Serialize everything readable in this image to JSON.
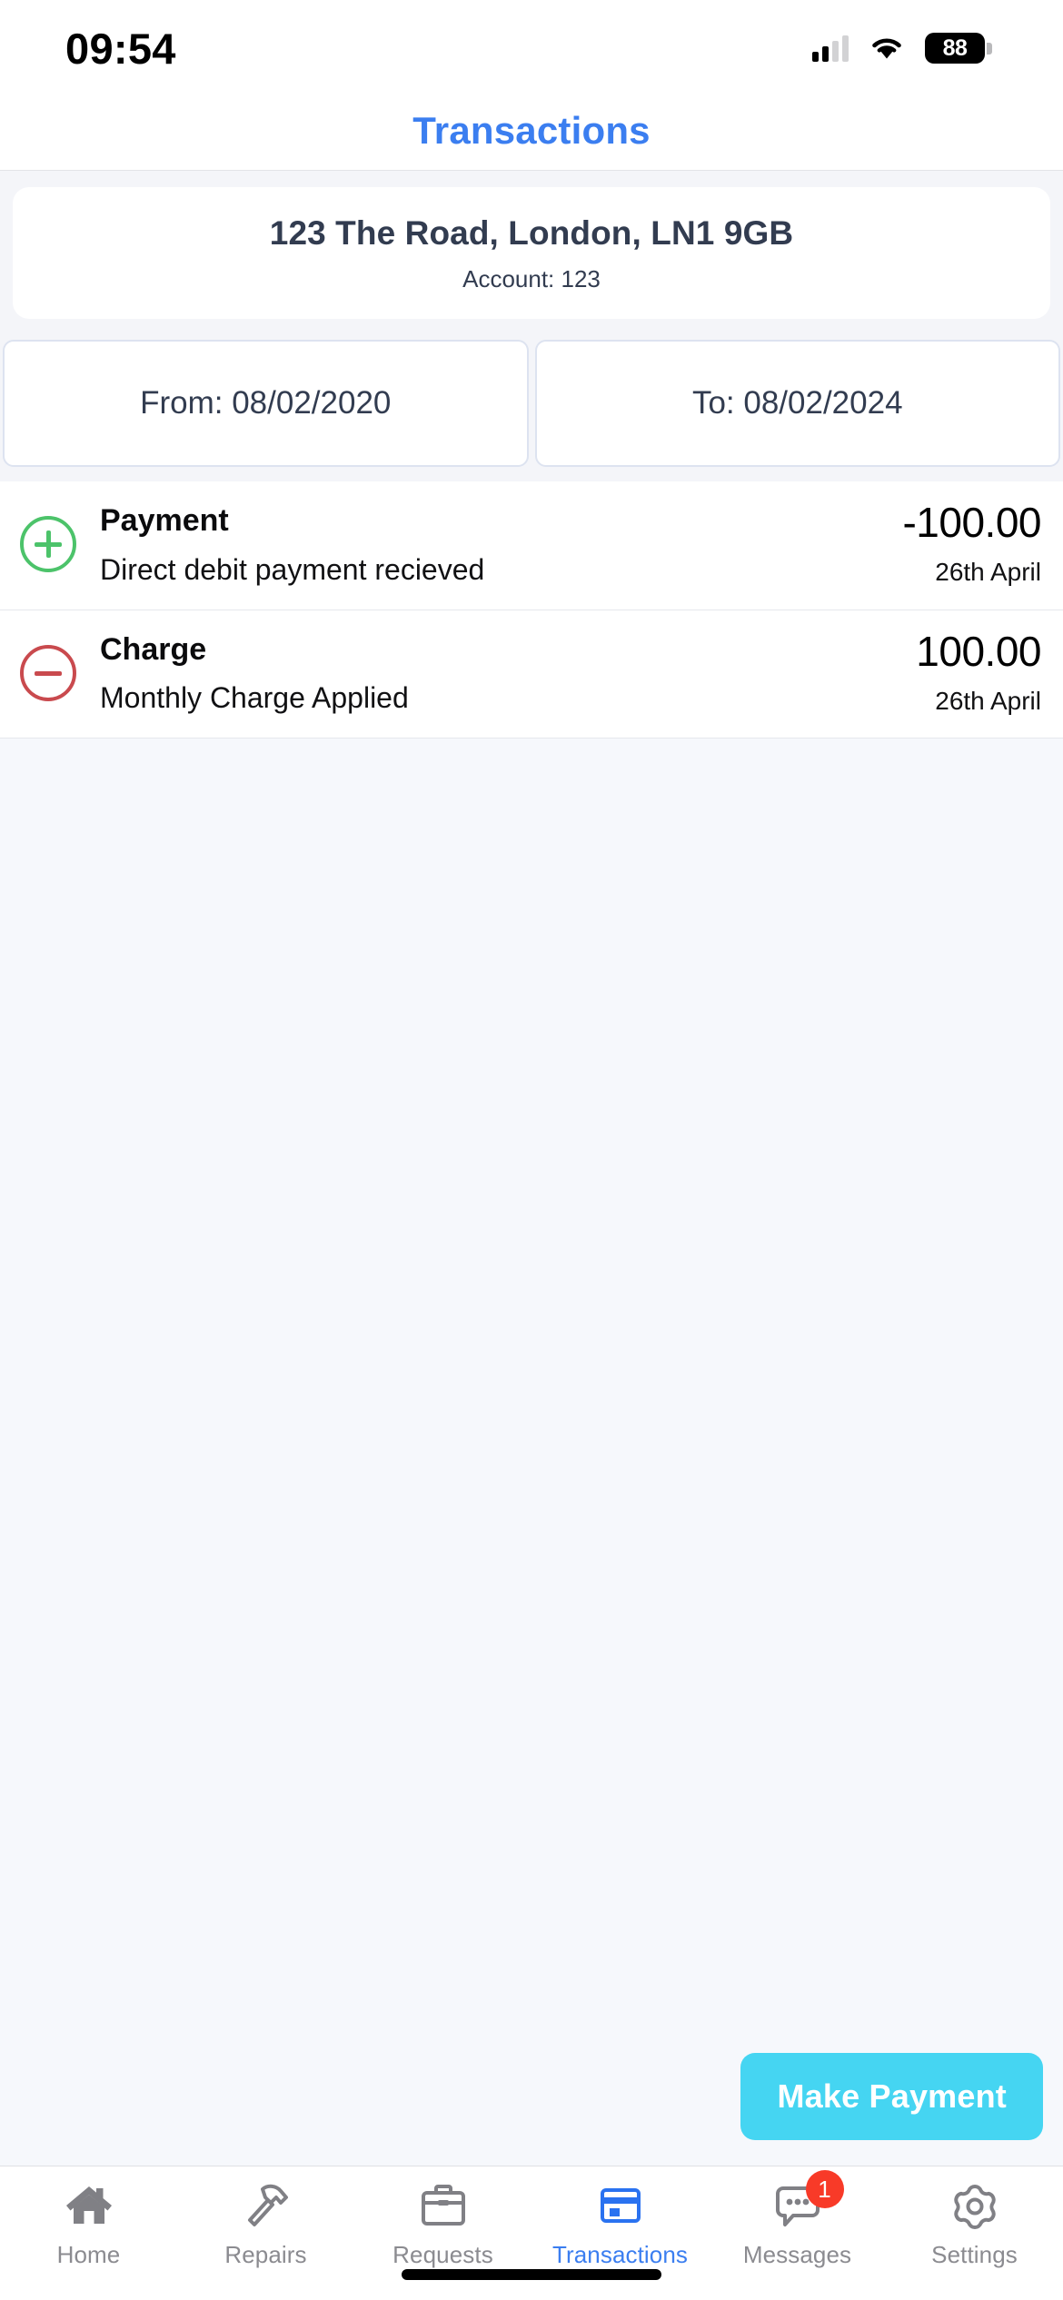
{
  "status_bar": {
    "time": "09:54",
    "cellular_icon": "cellular-signal-icon",
    "cellular_bars_filled": 2,
    "wifi_icon": "wifi-icon",
    "battery_icon": "battery-icon",
    "battery_level": "88"
  },
  "header": {
    "title": "Transactions",
    "title_color": "#3b7ef0"
  },
  "account_card": {
    "address": "123 The Road, London, LN1 9GB",
    "account_line": "Account: 123"
  },
  "date_filter": {
    "from": "From: 08/02/2020",
    "to": "To: 08/02/2024"
  },
  "transactions": [
    {
      "icon": "plus-circle-icon",
      "icon_color": "#4cc36a",
      "title": "Payment",
      "description": "Direct debit payment recieved",
      "amount": "-100.00",
      "date": "26th April"
    },
    {
      "icon": "minus-circle-icon",
      "icon_color": "#c94a4e",
      "title": "Charge",
      "description": "Monthly Charge Applied",
      "amount": "100.00",
      "date": "26th April"
    }
  ],
  "primary_action": {
    "label": "Make Payment",
    "color": "#45d5f2"
  },
  "tab_bar": {
    "active": "Transactions",
    "items": [
      {
        "label": "Home",
        "icon": "house-icon"
      },
      {
        "label": "Repairs",
        "icon": "hammer-icon"
      },
      {
        "label": "Requests",
        "icon": "briefcase-icon"
      },
      {
        "label": "Transactions",
        "icon": "credit-card-icon"
      },
      {
        "label": "Messages",
        "icon": "chat-bubble-icon",
        "badge": "1"
      },
      {
        "label": "Settings",
        "icon": "gear-icon"
      }
    ]
  }
}
